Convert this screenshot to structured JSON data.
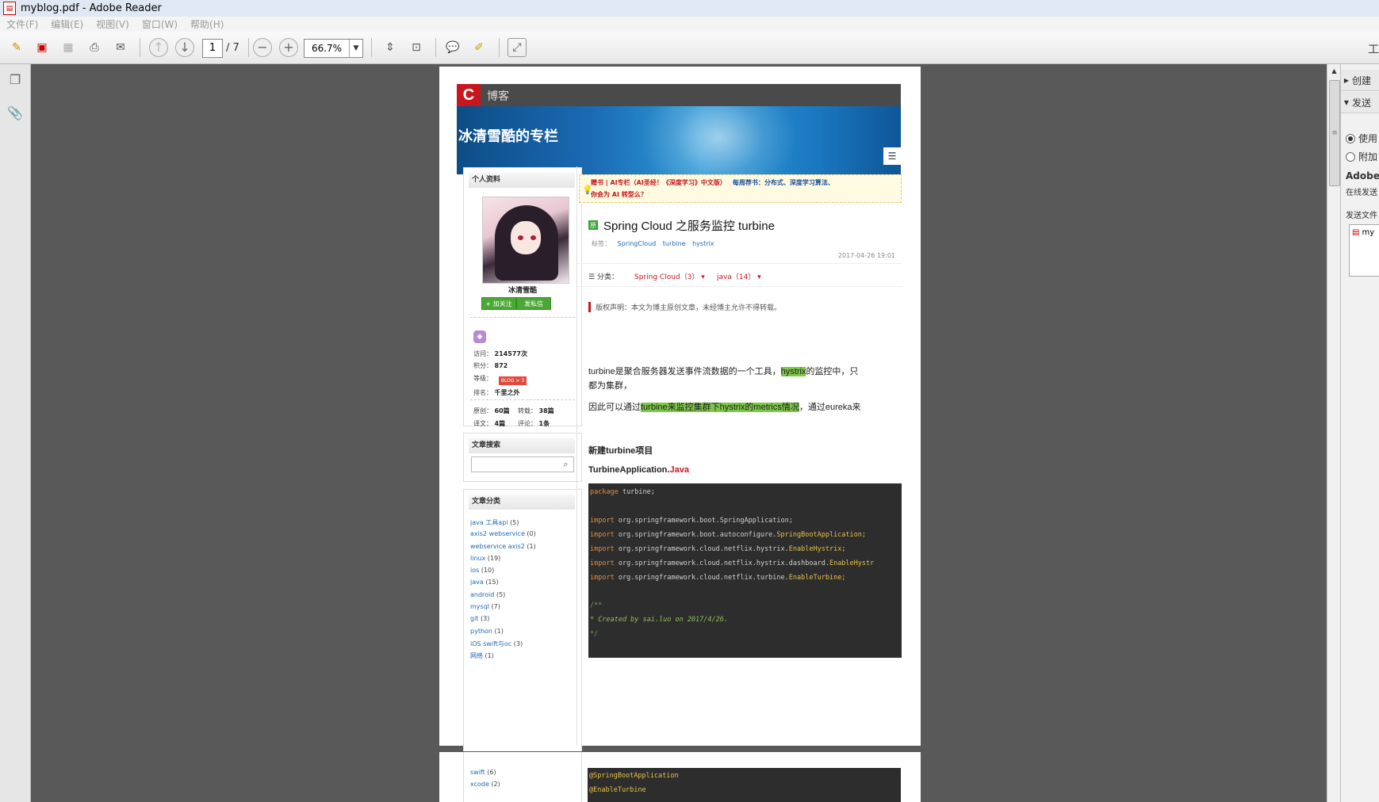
{
  "window": {
    "title": "myblog.pdf - Adobe Reader"
  },
  "menu": {
    "items": [
      "文件(F)",
      "编辑(E)",
      "视图(V)",
      "窗口(W)",
      "帮助(H)"
    ]
  },
  "toolbar": {
    "page_current": "1",
    "page_total": "/ 7",
    "zoom": "66.7%",
    "tools_label": "工"
  },
  "right_panel": {
    "create_label": "创建",
    "send_label": "发送",
    "radio_use": "使用",
    "radio_attach": "附加",
    "adobe_label": "Adobe",
    "online_label": "在线发送",
    "send_files_label": "发送文件",
    "file_label": "my"
  },
  "blog": {
    "brand": "博客",
    "logo_letter": "C",
    "column_title": "冰清雪酷的专栏",
    "profile": {
      "heading": "个人资料",
      "username": "冰清雪酷",
      "follow_btn": "+ 加关注",
      "message_btn": "发私信",
      "visits_label": "访问：",
      "visits": "214577次",
      "points_label": "积分：",
      "points": "872",
      "level_label": "等级：",
      "level_badge": "BLOG > 3",
      "rank_label": "排名：",
      "rank": "千里之外",
      "original_label": "原创：",
      "original": "60篇",
      "repost_label": "转载：",
      "repost": "38篇",
      "translated_label": "译文：",
      "translated": "4篇",
      "comments_label": "评论：",
      "comments": "1条"
    },
    "search": {
      "heading": "文章搜索",
      "placeholder": ""
    },
    "categories": {
      "heading": "文章分类",
      "items": [
        {
          "name": "java 工具api",
          "count": "(5)"
        },
        {
          "name": "axis2 webservice",
          "count": "(0)"
        },
        {
          "name": "webservice axis2",
          "count": "(1)"
        },
        {
          "name": "linux",
          "count": "(19)"
        },
        {
          "name": "ios",
          "count": "(10)"
        },
        {
          "name": "java",
          "count": "(15)"
        },
        {
          "name": "android",
          "count": "(5)"
        },
        {
          "name": "mysql",
          "count": "(7)"
        },
        {
          "name": "git",
          "count": "(3)"
        },
        {
          "name": "python",
          "count": "(1)"
        },
        {
          "name": "iOS swift与oc",
          "count": "(3)"
        },
        {
          "name": "网络",
          "count": "(1)"
        }
      ],
      "page2_items": [
        {
          "name": "swift",
          "count": "(6)"
        },
        {
          "name": "xcode",
          "count": "(2)"
        }
      ]
    },
    "notice": {
      "line1_red": "赠书 | AI专栏（AI圣经！《深度学习》中文版）",
      "line1_blue": "每周荐书：分布式、深度学习算法、",
      "line2": "你会为 AI 转型么？"
    },
    "article": {
      "title": "Spring Cloud 之服务监控 turbine",
      "tags_label": "标签：",
      "tags": [
        "SpringCloud",
        "turbine",
        "hystrix"
      ],
      "date": "2017-04-26 19:01",
      "category_label": "分类：",
      "category1": "Spring Cloud（3）",
      "category2": "java（14）",
      "copyright": "版权声明：本文为博主原创文章，未经博主允许不得转载。",
      "para1_a": "turbine是聚合服务器发送事件流数据的一个工具，",
      "para1_hl": "hystrix",
      "para1_b": "的监控中，只",
      "para1_c": "都为集群，",
      "para2_a": "因此可以通过",
      "para2_hl": "turbine来监控集群下hystrix的metrics情况",
      "para2_b": "，通过eureka来",
      "section": "新建turbine项目",
      "file_name": "TurbineApplication.",
      "file_ext": "Java",
      "code": {
        "l1_kw": "package",
        "l1": " turbine;",
        "imports": [
          {
            "kw": "import",
            "pkg": " org.springframework.boot.SpringApplication;",
            "cls": ""
          },
          {
            "kw": "import",
            "pkg": " org.springframework.boot.autoconfigure.",
            "cls": "SpringBootApplication;"
          },
          {
            "kw": "import",
            "pkg": " org.springframework.cloud.netflix.hystrix.",
            "cls": "EnableHystrix;"
          },
          {
            "kw": "import",
            "pkg": " org.springframework.cloud.netflix.hystrix.dashboard.",
            "cls": "EnableHystr"
          },
          {
            "kw": "import",
            "pkg": " org.springframework.cloud.netflix.turbine.",
            "cls": "EnableTurbine;"
          }
        ],
        "c1": "/**",
        "c2": " * Created by sai.luo on 2017/4/26.",
        "c3": " */",
        "p2_l1": "@SpringBootApplication",
        "p2_l2": "@EnableTurbine"
      }
    }
  }
}
